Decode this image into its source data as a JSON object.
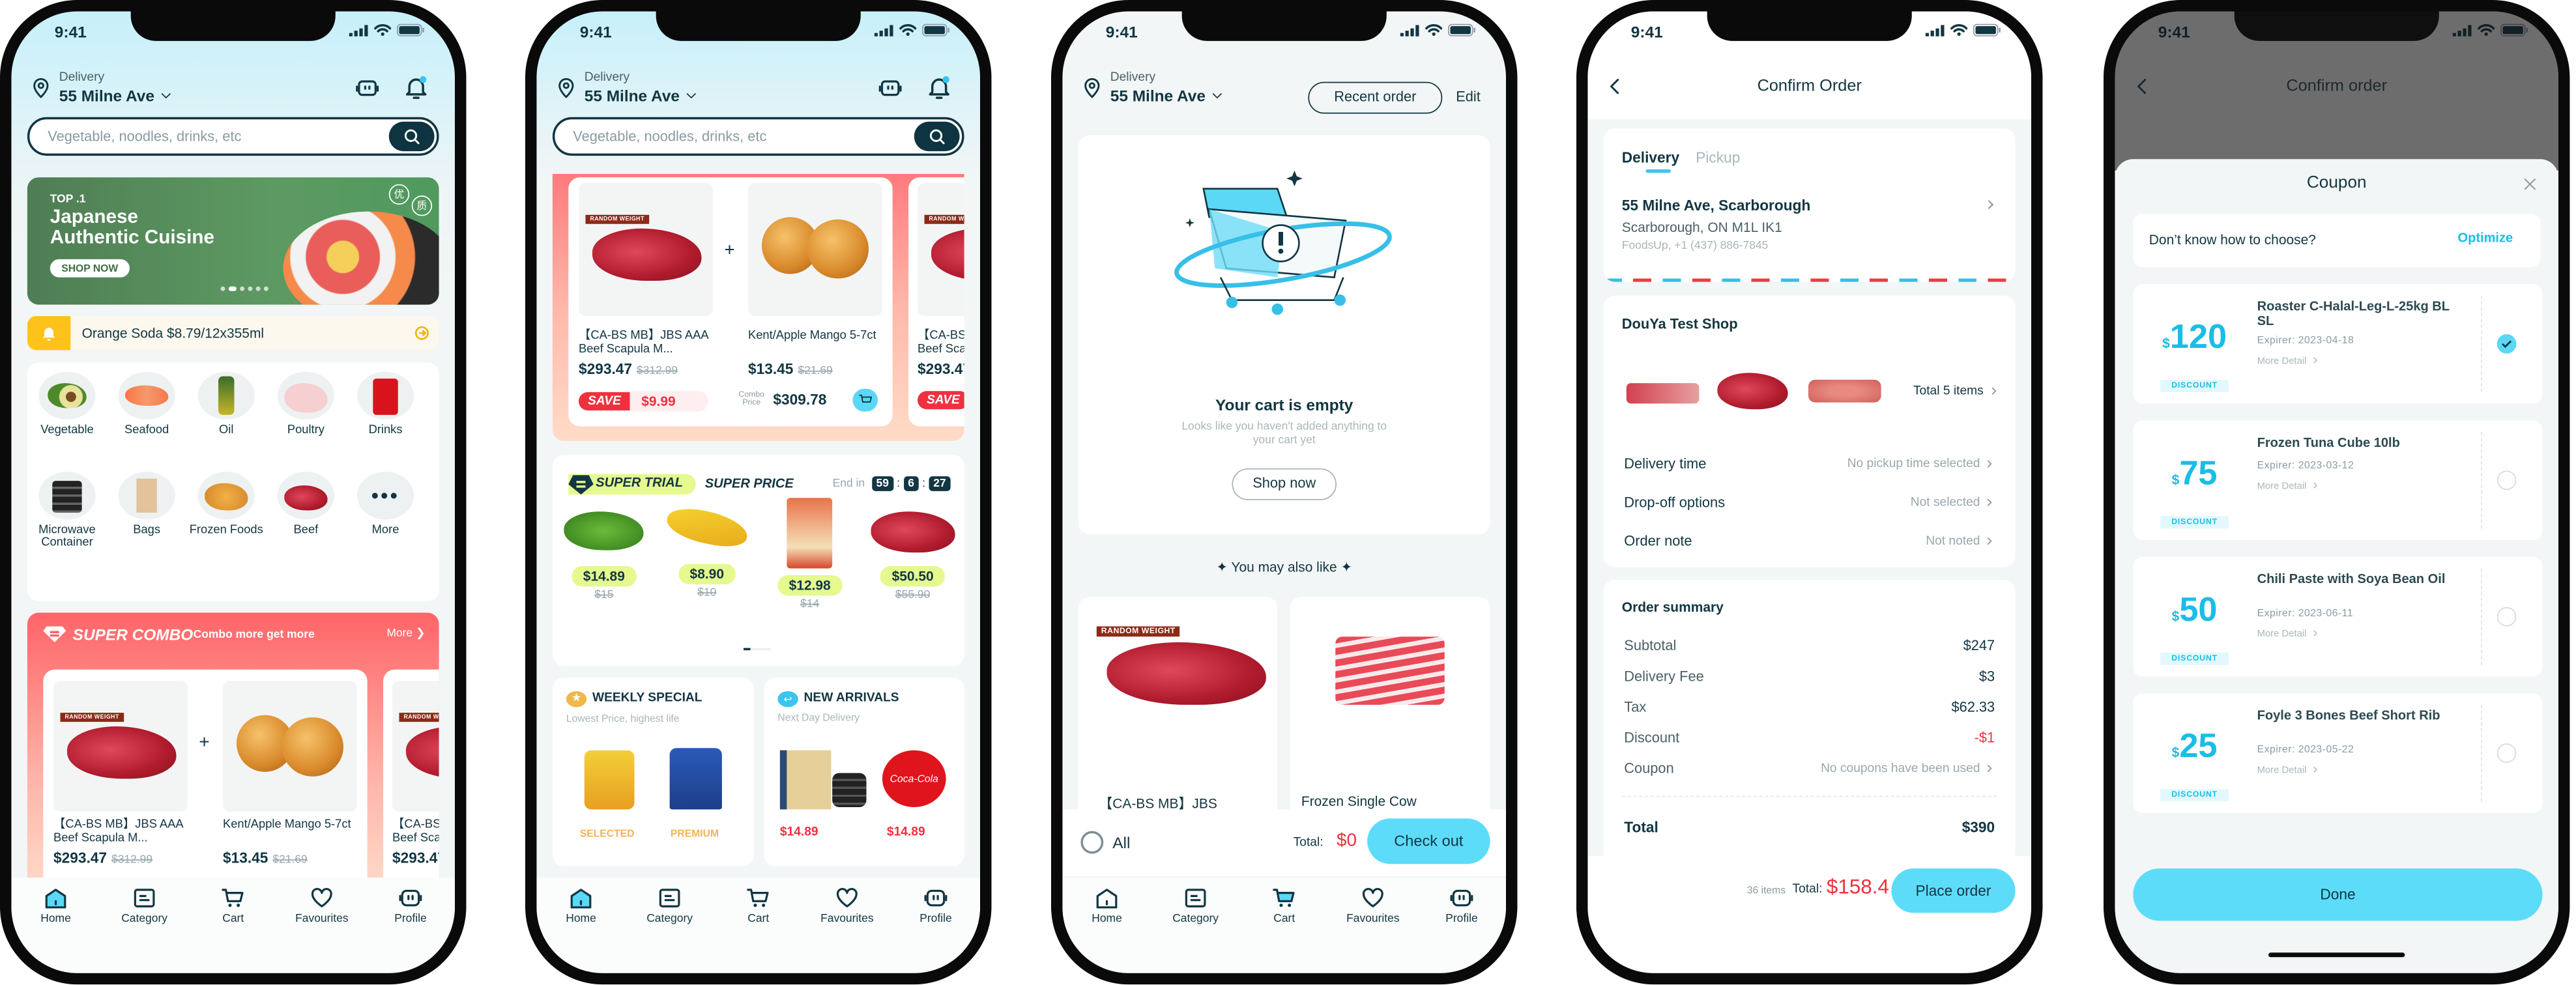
{
  "status": {
    "time": "9:41"
  },
  "header": {
    "delivery_label": "Delivery",
    "address": "55 Milne Ave",
    "search_placeholder": "Vegetable, noodles, drinks, etc"
  },
  "nav": [
    {
      "label": "Home",
      "icon": "home-icon"
    },
    {
      "label": "Category",
      "icon": "category-icon"
    },
    {
      "label": "Cart",
      "icon": "cart-icon"
    },
    {
      "label": "Favourites",
      "icon": "heart-icon"
    },
    {
      "label": "Profile",
      "icon": "profile-icon"
    }
  ],
  "home": {
    "banner": {
      "top": "TOP .1",
      "title_line1": "Japanese",
      "title_line2": "Authentic Cuisine",
      "button": "SHOP NOW",
      "badge1": "优",
      "badge2": "质"
    },
    "notice": "Orange Soda $8.79/12x355ml",
    "categories": [
      "Vegetable",
      "Seafood",
      "Oil",
      "Poultry",
      "Drinks",
      "Microwave Container",
      "Bags",
      "Frozen Foods",
      "Beef",
      "More"
    ],
    "combo": {
      "title": "SUPER COMBO",
      "subtitle": "Combo more get more",
      "more": "More",
      "random_weight": "RANDOM WEIGHT",
      "products": [
        {
          "name": "【CA-BS MB】JBS AAA Beef Scapula M...",
          "price": "$293.47",
          "old_price": "$312.99"
        },
        {
          "name": "Kent/Apple Mango 5-7ct",
          "price": "$13.45",
          "old_price": "$21.69"
        },
        {
          "name": "【CA-BS MB】JBS AAA Beef Scapula M...",
          "price": "$293.47"
        }
      ],
      "save_label": "SAVE",
      "save_amount": "$9.99",
      "combo_price_label": "Combo Price",
      "combo_price": "$309.78"
    }
  },
  "home_scrolled": {
    "super_trial": {
      "title": "SUPER TRIAL",
      "subtitle": "SUPER PRICE",
      "end_label": "End in",
      "timer": [
        "59",
        "6",
        "27"
      ],
      "items": [
        {
          "price": "$14.89",
          "old_price": "$15"
        },
        {
          "price": "$8.90",
          "old_price": "$10"
        },
        {
          "price": "$12.98",
          "old_price": "$14"
        },
        {
          "price": "$50.50",
          "old_price": "$55.90"
        }
      ]
    },
    "weekly": {
      "title": "WEEKLY SPECIAL",
      "subtitle": "Lowest Price, highest life",
      "labels": [
        "SELECTED",
        "PREMIUM"
      ]
    },
    "new_arrivals": {
      "title": "NEW ARRIVALS",
      "subtitle": "Next Day Delivery",
      "prices": [
        "$14.89",
        "$14.89"
      ]
    }
  },
  "cart": {
    "recent_order": "Recent order",
    "edit": "Edit",
    "empty_title": "Your cart is empty",
    "empty_desc": "Looks like you haven't added anything to your cart yet",
    "shop_now": "Shop now",
    "also_like": "You may also like",
    "recommendations": [
      "【CA-BS MB】JBS",
      "Frozen Single Cow"
    ],
    "select_all": "All",
    "total_label": "Total:",
    "total": "$0",
    "checkout": "Check out"
  },
  "confirm": {
    "title": "Confirm Order",
    "tabs": [
      "Delivery",
      "Pickup"
    ],
    "address_line1": "55 Milne Ave, Scarborough",
    "address_line2": "Scarborough, ON M1L IK1",
    "address_line3": "FoodsUp, +1 (437) 886-7845",
    "shop": "DouYa Test Shop",
    "total_items": "Total 5 items",
    "options": [
      {
        "label": "Delivery time",
        "value": "No pickup time selected"
      },
      {
        "label": "Drop-off options",
        "value": "Not selected"
      },
      {
        "label": "Order note",
        "value": "Not noted"
      }
    ],
    "summary_title": "Order summary",
    "summary": [
      {
        "label": "Subtotal",
        "value": "$247"
      },
      {
        "label": "Delivery Fee",
        "value": "$3"
      },
      {
        "label": "Tax",
        "value": "$62.33"
      },
      {
        "label": "Discount",
        "value": "-$1"
      },
      {
        "label": "Coupon",
        "value": "No coupons have been used"
      }
    ],
    "total_label": "Total",
    "total_value": "$390",
    "items_count": "36 items",
    "footer_total_label": "Total:",
    "footer_total": "$158.4",
    "place_order": "Place order"
  },
  "coupon": {
    "bg_title": "Confirm order",
    "title": "Coupon",
    "hint": "Don’t know how to choose?",
    "optimize": "Optimize",
    "discount_label": "DISCOUNT",
    "more_detail": "More Detail",
    "currency": "$",
    "items": [
      {
        "amount": "120",
        "name": "Roaster C-Halal-Leg-L-25kg BL SL",
        "expiry": "Expirer: 2023-04-18",
        "selected": true
      },
      {
        "amount": "75",
        "name": "Frozen Tuna Cube 10lb",
        "expiry": "Expirer: 2023-03-12",
        "selected": false
      },
      {
        "amount": "50",
        "name": "Chili Paste with Soya Bean Oil",
        "expiry": "Expirer: 2023-06-11",
        "selected": false
      },
      {
        "amount": "25",
        "name": "Foyle 3 Bones Beef Short Rib",
        "expiry": "Expirer: 2023-05-22",
        "selected": false
      }
    ],
    "done": "Done"
  },
  "colors": {
    "primary_dark": "#123642",
    "accent": "#5ad8f5",
    "price_red": "#f0303f",
    "combo_red": "#ff6468",
    "trial_lime": "#e5f98f"
  }
}
